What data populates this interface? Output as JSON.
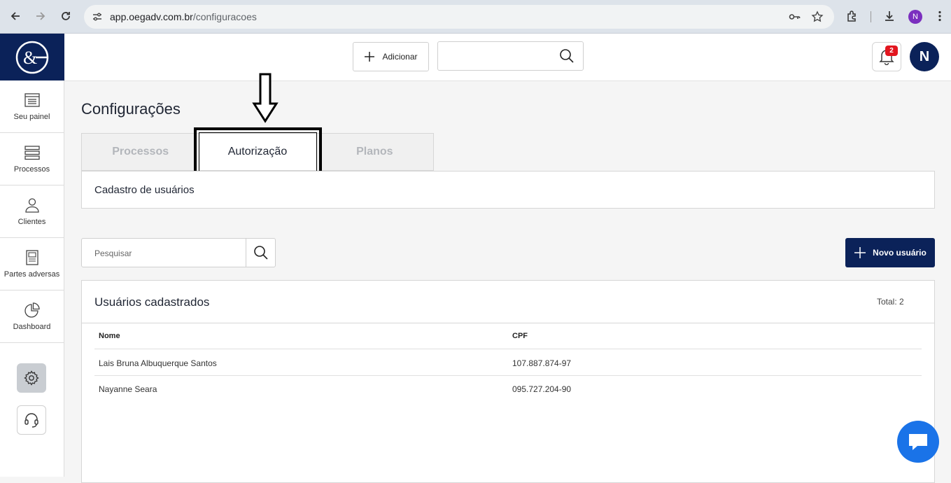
{
  "browser": {
    "url_host": "app.oegadv.com.br",
    "url_path": "/configuracoes",
    "profile_initial": "N"
  },
  "header": {
    "add_label": "Adicionar",
    "notifications_count": "2",
    "avatar_initial": "N"
  },
  "sidebar": {
    "items": [
      {
        "label": "Seu painel"
      },
      {
        "label": "Processos"
      },
      {
        "label": "Clientes"
      },
      {
        "label": "Partes adversas"
      },
      {
        "label": "Dashboard"
      }
    ]
  },
  "page": {
    "title": "Configurações",
    "tabs": [
      {
        "label": "Processos",
        "active": false
      },
      {
        "label": "Autorização",
        "active": true
      },
      {
        "label": "Planos",
        "active": false
      }
    ],
    "section_label": "Cadastro de usuários",
    "search_placeholder": "Pesquisar",
    "new_user_label": "Novo usuário"
  },
  "users": {
    "title": "Usuários cadastrados",
    "total": "Total: 2",
    "columns": [
      "Nome",
      "CPF"
    ],
    "rows": [
      {
        "name": "Lais Bruna Albuquerque Santos",
        "cpf": "107.887.874-97"
      },
      {
        "name": "Nayanne Seara",
        "cpf": "095.727.204-90"
      }
    ]
  },
  "colors": {
    "brand": "#0b2259",
    "badge": "#e2161f",
    "chat": "#1a73e8"
  }
}
